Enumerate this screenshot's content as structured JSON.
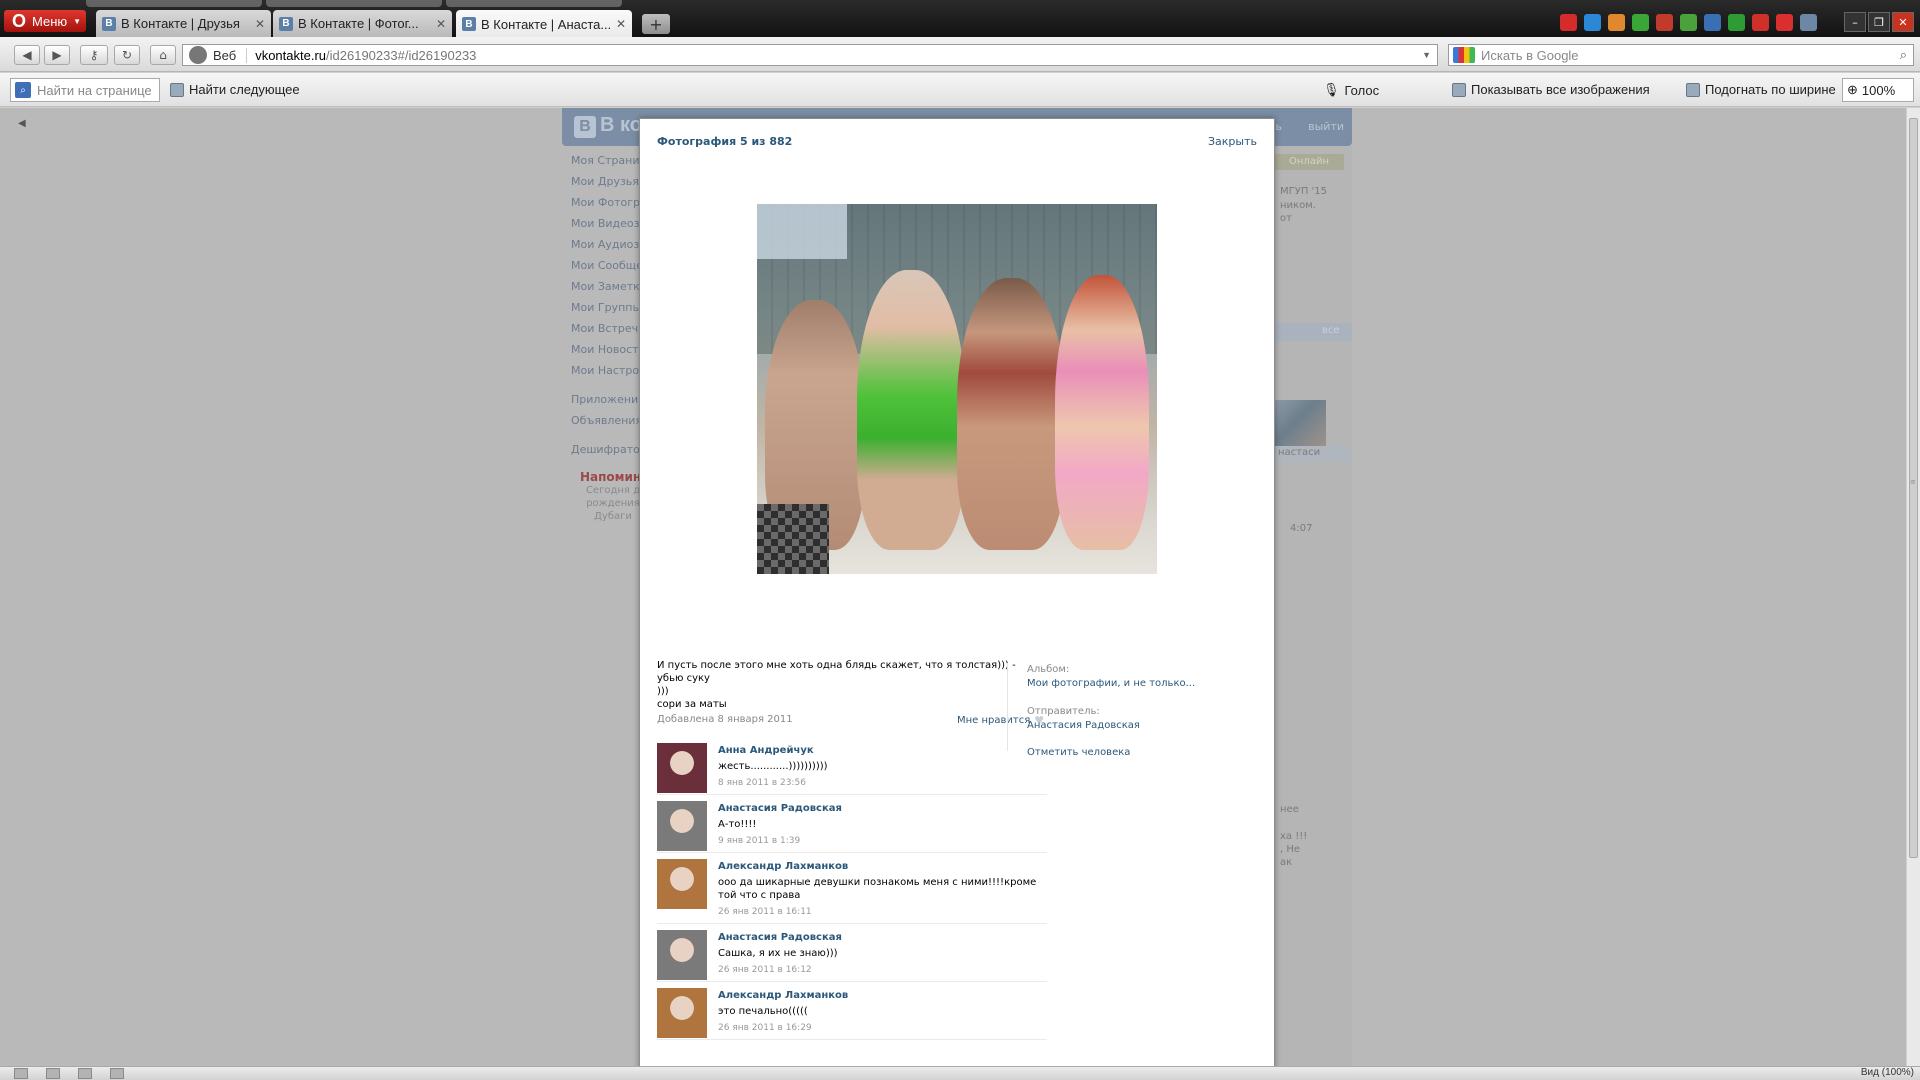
{
  "browser": {
    "menu_label": "Меню",
    "tabs": [
      {
        "label": "В Контакте | Друзья",
        "active": false
      },
      {
        "label": "В Контакте | Фотог...",
        "active": false
      },
      {
        "label": "В Контакте | Анаста...",
        "active": true
      }
    ],
    "new_tab_label": "+",
    "nav": {
      "back_icon": "back-arrow-icon",
      "forward_icon": "forward-arrow-icon",
      "key_icon": "key-icon",
      "reload_icon": "reload-icon",
      "home_icon": "home-icon"
    },
    "address": {
      "prefix": "Веб",
      "host": "vkontakte.ru",
      "path": "/id26190233#/id26190233"
    },
    "search": {
      "placeholder": "Искать в Google"
    },
    "extension_colors": [
      "#d62b2b",
      "#2b88d6",
      "#e0882d",
      "#3aa635",
      "#c23a2a",
      "#4aa23a",
      "#3b6fb4",
      "#2f9b35",
      "#d0302a",
      "#d9302f",
      "#6c88a6"
    ]
  },
  "findbar": {
    "find_placeholder": "Найти на странице",
    "find_next": "Найти следующее",
    "voice": "Голос",
    "show_images": "Показывать все изображения",
    "fit_width": "Подогнать по ширине",
    "zoom": "100%"
  },
  "vk_background": {
    "logo": "В кон",
    "logout": "выйти",
    "sep": "ь",
    "menu": [
      "Моя Страница",
      "Мои Друзья",
      "Мои Фотографии",
      "Мои Видеозаписи",
      "Мои Аудиозаписи",
      "Мои Сообщения",
      "Мои Заметки",
      "Мои Группы",
      "Мои Встречи",
      "Мои Новости",
      "Мои Настройки"
    ],
    "menu2": [
      "Приложения",
      "Объявления"
    ],
    "menu3": [
      "Дешифратор"
    ],
    "reminder_title": "Напомина",
    "reminder_text": "Сегодня д\nрождения\nДубаги",
    "right_column": {
      "online": "Онлайн",
      "uni": "МГУП '15",
      "line2": "ником.",
      "line3": "от",
      "all": "все",
      "anastasia": "настаси",
      "time": "4:07",
      "line_a": "нее",
      "line_b": "ха !!!",
      "line_c": ", Не",
      "line_d": "ак"
    }
  },
  "photo_view": {
    "title": "Фотография 5 из 882",
    "close": "Закрыть",
    "caption": "И пусть после этого мне хоть одна блядь скажет, что я толстая))) - убью суку\n)))\nсори за маты",
    "added": "Добавлена 8 января 2011",
    "like": "Мне нравится",
    "album_label": "Альбом:",
    "album_value": "Мои фотографии, и не только...",
    "sender_label": "Отправитель:",
    "sender_value": "Анастасия Радовская",
    "tag_person": "Отметить человека",
    "comments": [
      {
        "author": "Анна Андрейчук",
        "text": "жесть............))))))))))",
        "time": "8 янв 2011 в 23:56",
        "avatar_color": "#6a2f3a"
      },
      {
        "author": "Анастасия Радовская",
        "text": "А-то!!!!",
        "time": "9 янв 2011 в 1:39",
        "avatar_color": "#7a7a7a"
      },
      {
        "author": "Александр Лахманков",
        "text": "ооо да шикарные девушки познакомь меня с ними!!!!кроме той что с права",
        "time": "26 янв 2011 в 16:11",
        "avatar_color": "#b0743f"
      },
      {
        "author": "Анастасия Радовская",
        "text": "Сашка, я их не знаю)))",
        "time": "26 янв 2011 в 16:12",
        "avatar_color": "#7a7a7a"
      },
      {
        "author": "Александр Лахманков",
        "text": "это печально(((((",
        "time": "26 янв 2011 в 16:29",
        "avatar_color": "#b0743f"
      }
    ]
  },
  "statusbar": {
    "zoom": "Вид (100%)"
  }
}
